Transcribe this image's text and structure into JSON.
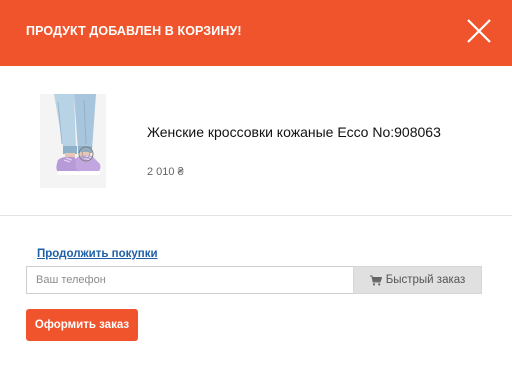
{
  "header": {
    "title": "ПРОДУКТ ДОБАВЛЕН В КОРЗИНУ!",
    "close_icon": "close-icon",
    "background_color": "#f0542d"
  },
  "product": {
    "image_icon": "product-image",
    "name": "Женские кроссовки кожаные Ecco No:908063",
    "price": "2 010 ₴"
  },
  "actions": {
    "continue_label": "Продолжить покупки",
    "phone_placeholder": "Ваш телефон",
    "phone_value": "",
    "quick_order_label": "Быстрый заказ",
    "quick_order_icon": "cart-icon",
    "checkout_label": "Оформить заказ",
    "accent_color": "#f0542d",
    "link_color": "#1f5fa8"
  }
}
